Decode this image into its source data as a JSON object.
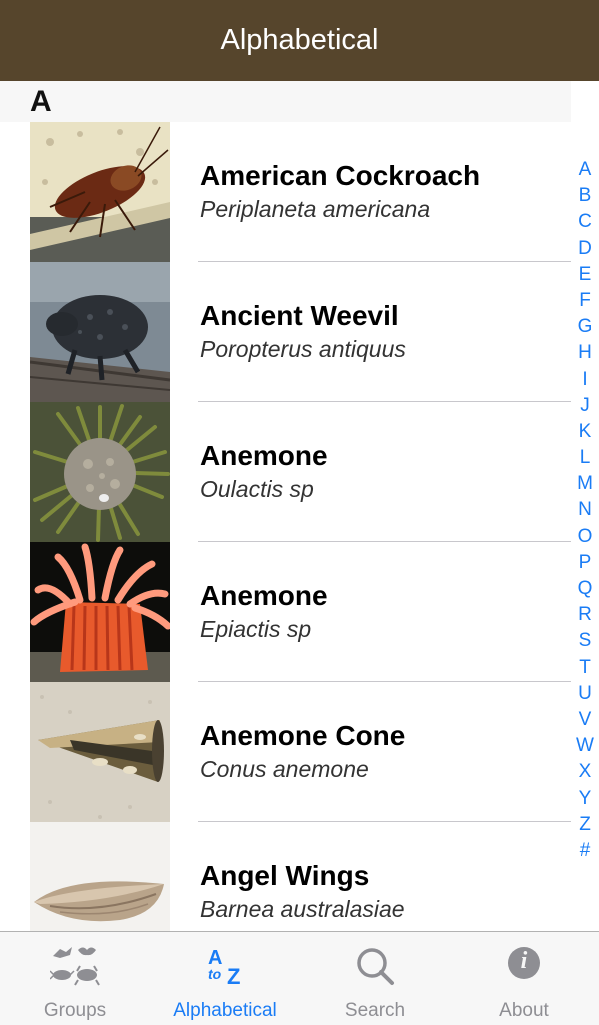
{
  "navbar": {
    "title": "Alphabetical"
  },
  "section": {
    "letter": "A"
  },
  "species": [
    {
      "common": "American Cockroach",
      "scientific": "Periplaneta americana"
    },
    {
      "common": "Ancient Weevil",
      "scientific": "Poropterus antiquus"
    },
    {
      "common": "Anemone",
      "scientific": "Oulactis sp"
    },
    {
      "common": "Anemone",
      "scientific": "Epiactis sp"
    },
    {
      "common": "Anemone Cone",
      "scientific": "Conus anemone"
    },
    {
      "common": "Angel Wings",
      "scientific": "Barnea australasiae"
    }
  ],
  "index_letters": [
    "A",
    "B",
    "C",
    "D",
    "E",
    "F",
    "G",
    "H",
    "I",
    "J",
    "K",
    "L",
    "M",
    "N",
    "O",
    "P",
    "Q",
    "R",
    "S",
    "T",
    "U",
    "V",
    "W",
    "X",
    "Y",
    "Z",
    "#"
  ],
  "tabs": [
    {
      "label": "Groups",
      "icon": "animal-groups-icon",
      "active": false
    },
    {
      "label": "Alphabetical",
      "icon": "a-to-z-icon",
      "active": true
    },
    {
      "label": "Search",
      "icon": "magnifier-icon",
      "active": false
    },
    {
      "label": "About",
      "icon": "info-icon",
      "active": false
    }
  ],
  "tab_icon_text": {
    "a_to_z_top": "A",
    "a_to_z_mid": "to",
    "a_to_z_bottom": "Z",
    "info_glyph": "i"
  },
  "colors": {
    "navbar": "#56452c",
    "accent": "#1a7cf5",
    "tab_inactive": "#8e8e93"
  }
}
